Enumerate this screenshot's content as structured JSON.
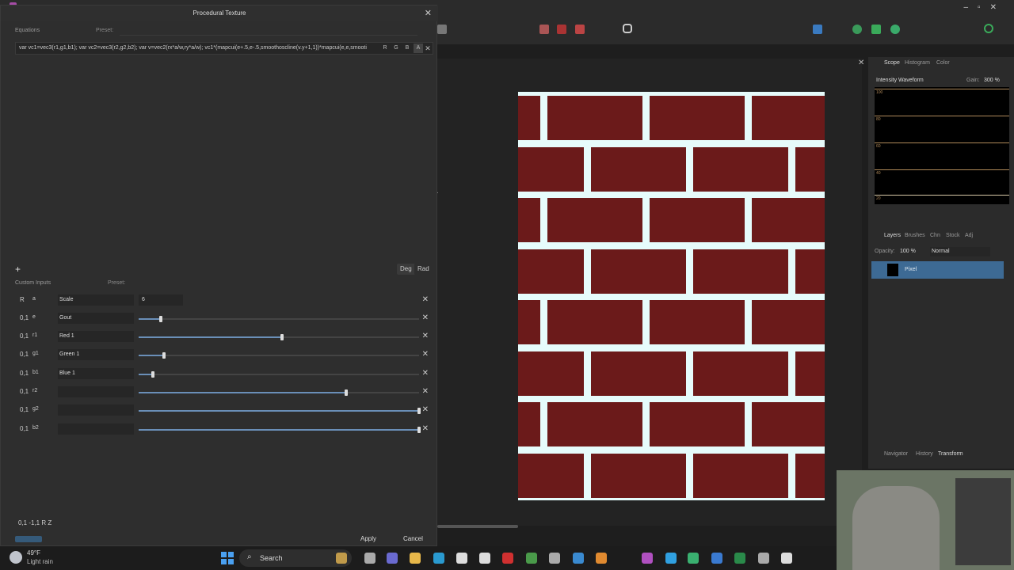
{
  "dialog": {
    "title": "Procedural Texture",
    "equations_label": "Equations",
    "preset_label": "Preset:",
    "equation_text": "var vc1=vec3(r1,g1,b1); var vc2=vec3(r2,g2,b2); var v=vec2(rx*a/w,ry*a/w); vc1*(mapcui(e+.5,e-.5,smoothoscline(v.y+1,1))*mapcui(e,e,smooti",
    "channels": [
      "R",
      "G",
      "B",
      "A"
    ],
    "add_symbol": "+",
    "deg_label": "Deg",
    "rad_label": "Rad",
    "custom_inputs_label": "Custom Inputs",
    "custom_preset_label": "Preset:",
    "inputs": [
      {
        "type": "R",
        "var": "a",
        "name": "Scale",
        "value": "6",
        "kind": "number"
      },
      {
        "type": "0,1",
        "var": "e",
        "name": "Gout",
        "level": 0.08,
        "kind": "slider"
      },
      {
        "type": "0,1",
        "var": "r1",
        "name": "Red 1",
        "level": 0.51,
        "kind": "slider"
      },
      {
        "type": "0,1",
        "var": "g1",
        "name": "Green 1",
        "level": 0.09,
        "kind": "slider"
      },
      {
        "type": "0,1",
        "var": "b1",
        "name": "Blue 1",
        "level": 0.05,
        "kind": "slider"
      },
      {
        "type": "0,1",
        "var": "r2",
        "name": "",
        "level": 0.74,
        "kind": "slider"
      },
      {
        "type": "0,1",
        "var": "g2",
        "name": "",
        "level": 1.0,
        "kind": "slider"
      },
      {
        "type": "0,1",
        "var": "b2",
        "name": "",
        "level": 1.0,
        "kind": "slider"
      }
    ],
    "footer_types": "0,1 -1,1 R Z",
    "apply_label": "Apply",
    "cancel_label": "Cancel"
  },
  "right_panel": {
    "tabs": [
      "Scope",
      "Histogram",
      "Color"
    ],
    "scope_mode": "Intensity Waveform",
    "gain_label": "Gain:",
    "gain_value": "300 %",
    "scope_ticks": [
      "100",
      "80",
      "60",
      "40",
      "20",
      "0"
    ],
    "layer_tabs": [
      "Layers",
      "Brushes",
      "Chn",
      "Stock",
      "Adj"
    ],
    "opacity_label": "Opacity:",
    "opacity_value": "100 %",
    "blend_mode": "Normal",
    "layer_name": "Pixel",
    "bottom_tabs": [
      "Navigator",
      "History",
      "Transform"
    ]
  },
  "taskbar": {
    "temperature": "49°F",
    "weather": "Light rain",
    "search_label": "Search"
  },
  "colors": {
    "brick": "#6b1a1a",
    "mortar": "#e6fbfb",
    "accent": "#6a8fb8"
  }
}
